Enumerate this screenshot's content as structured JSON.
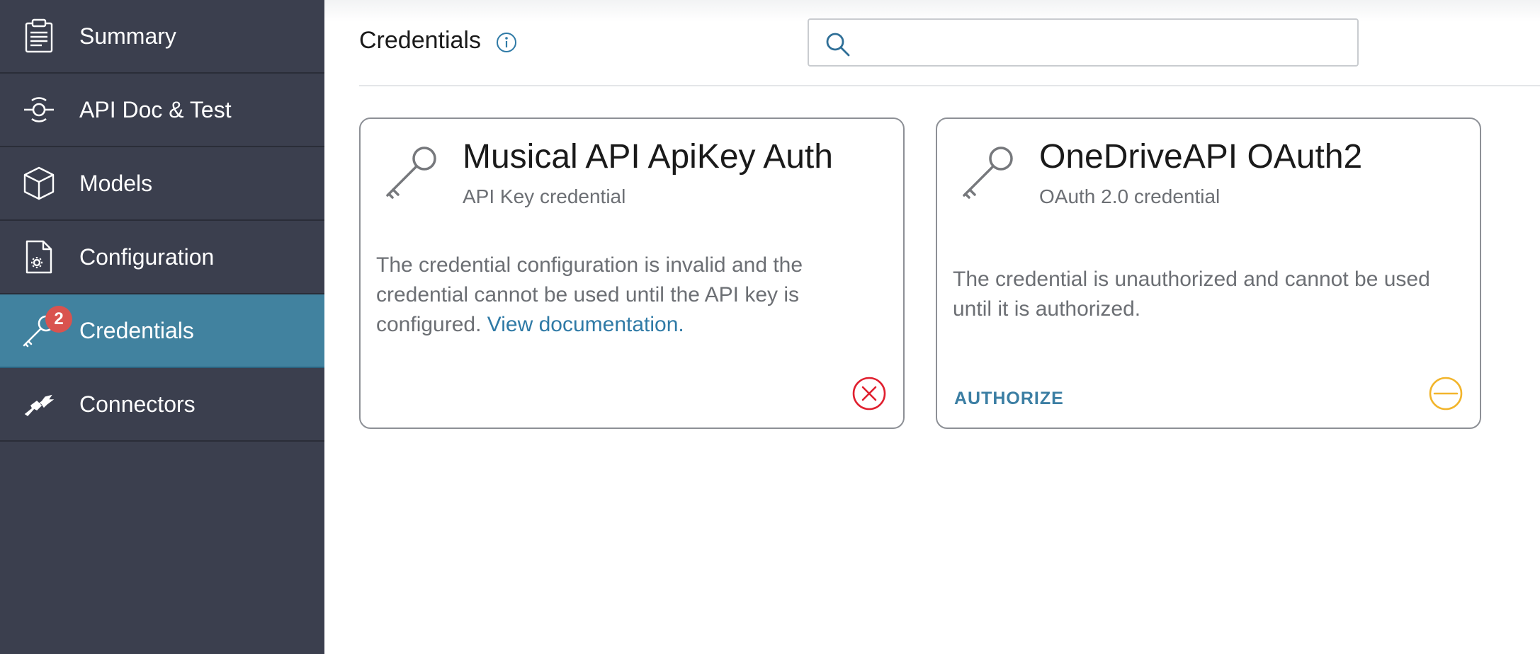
{
  "sidebar": {
    "items": [
      {
        "label": "Summary",
        "icon": "clipboard-icon"
      },
      {
        "label": "API Doc & Test",
        "icon": "api-doc-icon"
      },
      {
        "label": "Models",
        "icon": "cube-icon"
      },
      {
        "label": "Configuration",
        "icon": "config-file-icon"
      },
      {
        "label": "Credentials",
        "icon": "key-icon",
        "badge": "2",
        "active": true
      },
      {
        "label": "Connectors",
        "icon": "connector-icon"
      }
    ]
  },
  "header": {
    "title": "Credentials",
    "info_icon": "info-icon",
    "search_placeholder": ""
  },
  "cards": [
    {
      "title": "Musical API ApiKey Auth",
      "subtitle": "API Key credential",
      "description": "The credential configuration is invalid and the credential cannot be used until the API key is configured. ",
      "link_text": "View documentation.",
      "status": "error",
      "status_icon": "error-circle-icon",
      "status_color": "#e0202f"
    },
    {
      "title": "OneDriveAPI OAuth2",
      "subtitle": "OAuth 2.0 credential",
      "description": "The credential is unauthorized and cannot be used until it is authorized.",
      "action_label": "AUTHORIZE",
      "status": "warning",
      "status_icon": "minus-circle-icon",
      "status_color": "#f2b52c"
    }
  ],
  "colors": {
    "sidebar_bg": "#3b3f4e",
    "active_bg": "#41829f",
    "badge": "#d9534f",
    "accent": "#2f7aa6"
  }
}
